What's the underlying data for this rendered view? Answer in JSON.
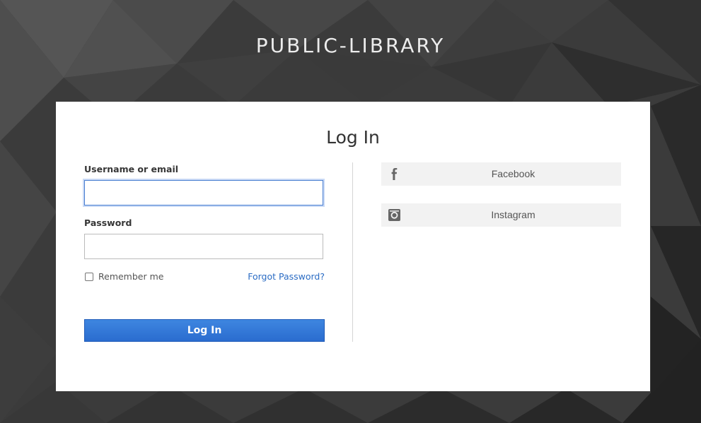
{
  "brand": {
    "title": "PUBLIC-LIBRARY"
  },
  "login": {
    "heading": "Log In",
    "username": {
      "label": "Username or email",
      "value": "",
      "placeholder": ""
    },
    "password": {
      "label": "Password",
      "value": "",
      "placeholder": ""
    },
    "remember_me": {
      "label": "Remember me",
      "checked": false
    },
    "forgot_password_label": "Forgot Password?",
    "submit_label": "Log In"
  },
  "social": {
    "providers": [
      {
        "label": "Facebook",
        "icon": "facebook-icon"
      },
      {
        "label": "Instagram",
        "icon": "instagram-icon"
      }
    ]
  },
  "colors": {
    "background": "#3a3a3a",
    "card": "#ffffff",
    "primary_button": "#2f73d6",
    "link": "#2b6cc4",
    "social_button_bg": "#f2f2f2"
  }
}
